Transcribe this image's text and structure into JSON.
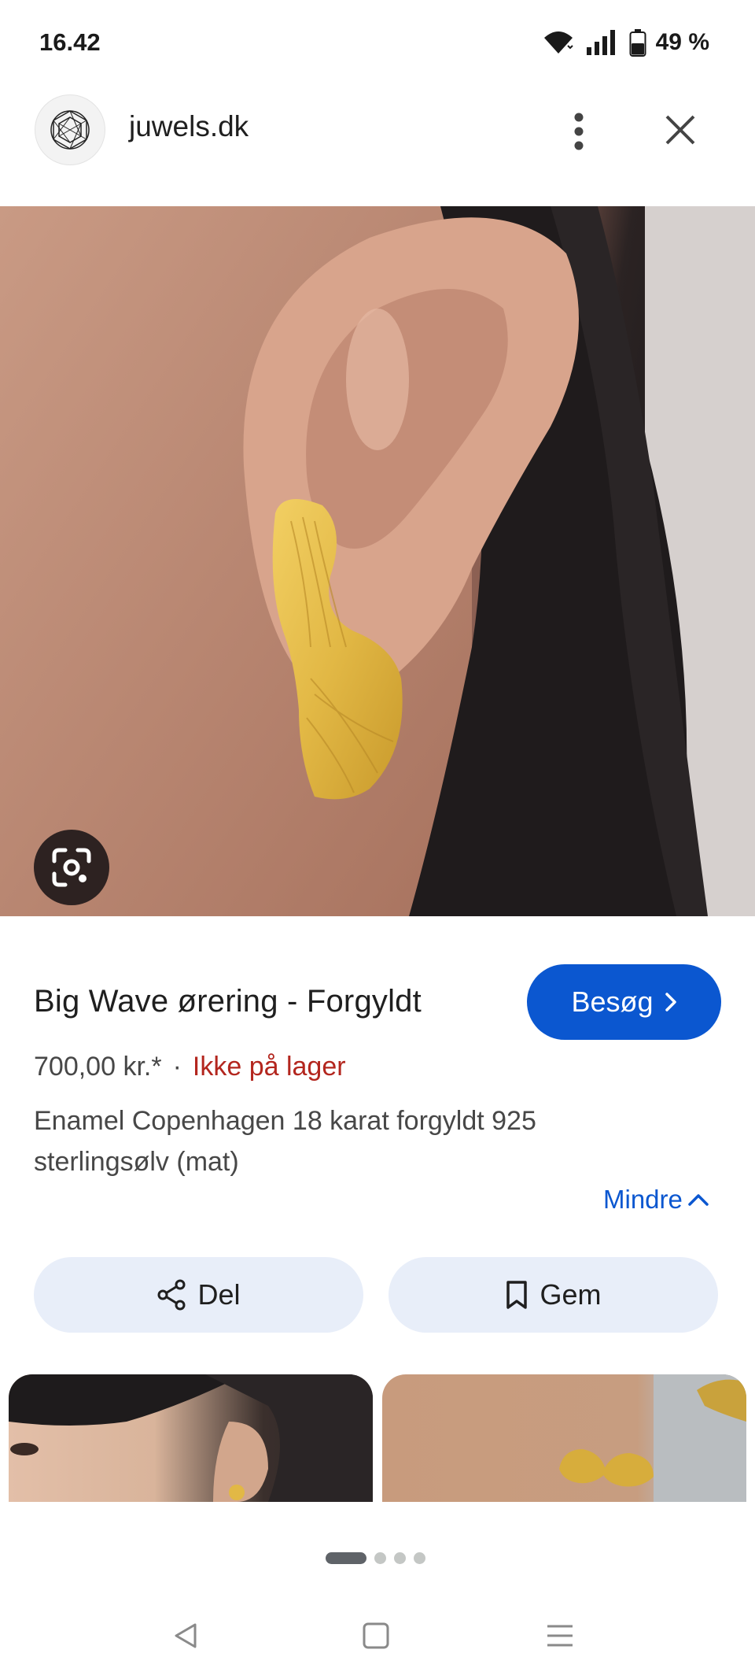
{
  "status_bar": {
    "time": "16.42",
    "battery": "49 %",
    "icons": [
      "wifi-icon",
      "signal-icon",
      "battery-icon"
    ]
  },
  "header": {
    "site_name": "juwels.dk",
    "logo_icon": "juwels-logo",
    "more_icon": "more-vert-icon",
    "close_icon": "close-icon"
  },
  "hero": {
    "lens_icon": "google-lens-icon"
  },
  "product": {
    "title": "Big Wave ørering - Forgyldt",
    "visit_label": "Besøg",
    "price": "700,00 kr.*",
    "separator": "·",
    "stock_status": "Ikke på lager",
    "description": "Enamel Copenhagen 18 karat forgyldt 925 sterlingsølv (mat)",
    "less_label": "Mindre"
  },
  "actions": {
    "share_label": "Del",
    "save_label": "Gem"
  },
  "colors": {
    "accent": "#0b57d0",
    "stock_red": "#b3261e",
    "chip_bg": "#e8eef9",
    "gold": "#e2b845"
  },
  "pager": {
    "total": 4,
    "active": 1
  },
  "nav": {
    "icons": [
      "back-icon",
      "home-icon",
      "recents-icon"
    ]
  }
}
